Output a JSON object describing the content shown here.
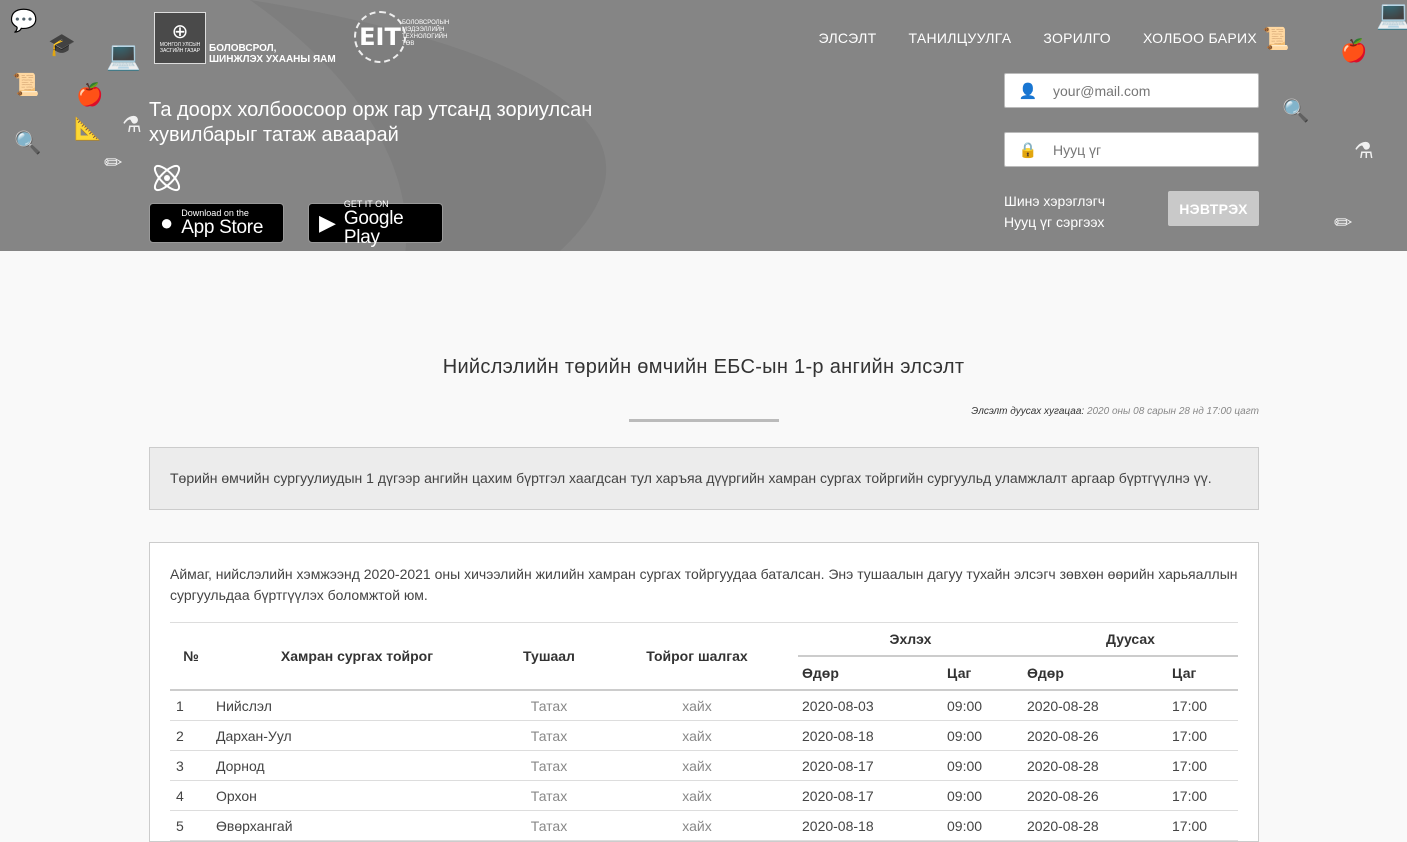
{
  "header": {
    "ministry": {
      "name_line1": "БОЛОВСРОЛ,",
      "name_line2": "ШИНЖЛЭХ УХААНЫ ЯАМ",
      "seal_text": "МОНГОЛ УЛСЫН ЗАСГИЙН ГАЗАР"
    },
    "eit": {
      "mark": "EIT",
      "text_line1": "БОЛОВСРОЛЫН",
      "text_line2": "МЭДЭЭЛЛИЙН",
      "text_line3": "ТЕХНОЛОГИЙН",
      "text_line4": "ТӨВ"
    },
    "nav": [
      {
        "label": "ЭЛСЭЛТ"
      },
      {
        "label": "ТАНИЛЦУУЛГА"
      },
      {
        "label": "ЗОРИЛГО"
      },
      {
        "label": "ХОЛБОО БАРИХ"
      }
    ],
    "promo_text": "Та доорх холбоосоор орж гар утсанд зориулсан хувилбарыг татаж аваарай",
    "appstore": {
      "small": "Download on the",
      "big": "App Store"
    },
    "googleplay": {
      "small": "GET IT ON",
      "big": "Google Play"
    },
    "login": {
      "email_placeholder": "your@mail.com",
      "password_placeholder": "Нууц үг",
      "new_user": "Шинэ хэрэглэгч",
      "reset_password": "Нууц үг сэргээх",
      "submit": "НЭВТРЭХ"
    }
  },
  "main": {
    "title": "Нийслэлийн төрийн өмчийн ЕБС-ын 1-р ангийн элсэлт",
    "deadline_label": "Элсэлт дуусах хугацаа:",
    "deadline_value": "2020 оны 08 сарын 28 нд 17:00 цагт",
    "notice": "Төрийн өмчийн сургуулиудын 1 дүгээр ангийн цахим бүртгэл хаагдсан тул харъяа дүүргийн хамран сургах тойргийн сургуульд уламжлалт аргаар бүртгүүлнэ үү.",
    "panel_text": "Аймаг, нийслэлийн хэмжээнд 2020-2021 оны хичээлийн жилийн хамран сургах тойргуудаа баталсан. Энэ тушаалын дагуу тухайн элсэгч зөвхөн өөрийн харьяаллын сургуульдаа бүртгүүлэх боломжтой юм.",
    "table": {
      "headers": {
        "num": "№",
        "district": "Хамран сургах тойрог",
        "order": "Тушаал",
        "check": "Тойрог шалгах",
        "start": "Эхлэх",
        "end": "Дуусах",
        "date": "Өдөр",
        "time": "Цаг"
      },
      "rows": [
        {
          "num": "1",
          "name": "Нийслэл",
          "order": "Татах",
          "check": "хайх",
          "start_date": "2020-08-03",
          "start_time": "09:00",
          "end_date": "2020-08-28",
          "end_time": "17:00"
        },
        {
          "num": "2",
          "name": "Дархан-Уул",
          "order": "Татах",
          "check": "хайх",
          "start_date": "2020-08-18",
          "start_time": "09:00",
          "end_date": "2020-08-26",
          "end_time": "17:00"
        },
        {
          "num": "3",
          "name": "Дорнод",
          "order": "Татах",
          "check": "хайх",
          "start_date": "2020-08-17",
          "start_time": "09:00",
          "end_date": "2020-08-28",
          "end_time": "17:00"
        },
        {
          "num": "4",
          "name": "Орхон",
          "order": "Татах",
          "check": "хайх",
          "start_date": "2020-08-17",
          "start_time": "09:00",
          "end_date": "2020-08-26",
          "end_time": "17:00"
        },
        {
          "num": "5",
          "name": "Өвөрхангай",
          "order": "Татах",
          "check": "хайх",
          "start_date": "2020-08-18",
          "start_time": "09:00",
          "end_date": "2020-08-28",
          "end_time": "17:00"
        }
      ]
    }
  }
}
